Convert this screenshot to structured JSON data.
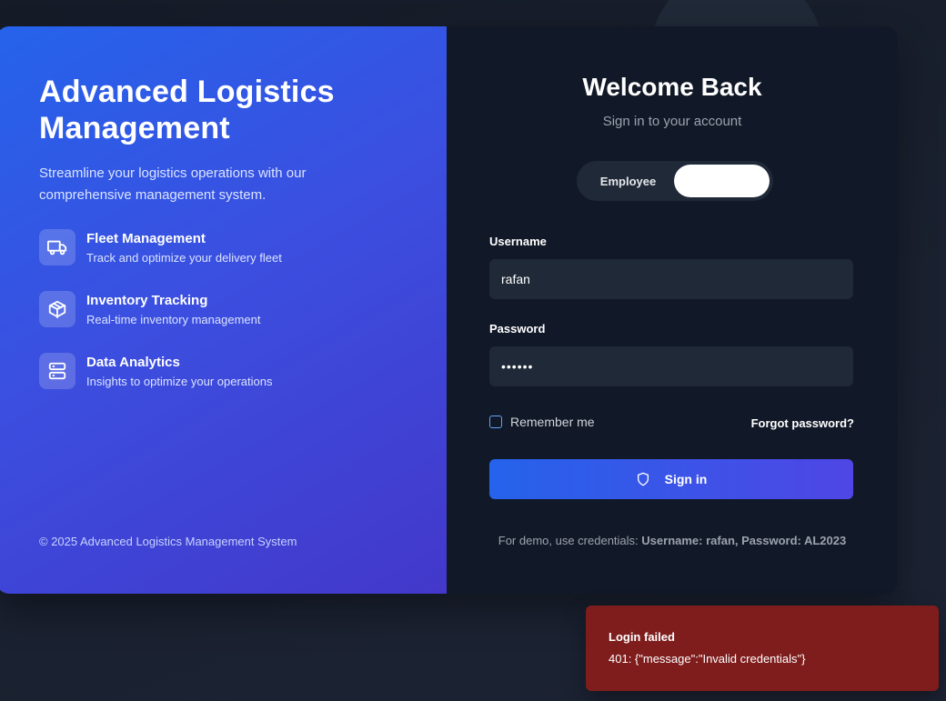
{
  "brand": {
    "title": "Advanced Logistics Management",
    "description": "Streamline your logistics operations with our comprehensive management system.",
    "features": [
      {
        "icon": "truck-icon",
        "title": "Fleet Management",
        "subtitle": "Track and optimize your delivery fleet"
      },
      {
        "icon": "package-icon",
        "title": "Inventory Tracking",
        "subtitle": "Real-time inventory management"
      },
      {
        "icon": "server-icon",
        "title": "Data Analytics",
        "subtitle": "Insights to optimize your operations"
      }
    ],
    "copyright": "© 2025 Advanced Logistics Management System"
  },
  "login": {
    "title": "Welcome Back",
    "subtitle": "Sign in to your account",
    "role_toggle": {
      "options": [
        "Employee",
        ""
      ],
      "selected_index": 1
    },
    "username": {
      "label": "Username",
      "value": "rafan"
    },
    "password": {
      "label": "Password",
      "value": "••••••"
    },
    "remember_label": "Remember me",
    "remember_checked": false,
    "forgot_label": "Forgot password?",
    "signin_label": "Sign in",
    "demo_prefix": "For demo, use credentials: ",
    "demo_credentials": "Username: rafan, Password: AL2023"
  },
  "toast": {
    "title": "Login failed",
    "message": "401: {\"message\":\"Invalid credentials\"}"
  },
  "colors": {
    "accent_start": "#2563eb",
    "accent_end": "#4f46e5",
    "panel_dark": "#111827",
    "field_bg": "#1f2937",
    "error_bg": "#7f1d1d"
  }
}
